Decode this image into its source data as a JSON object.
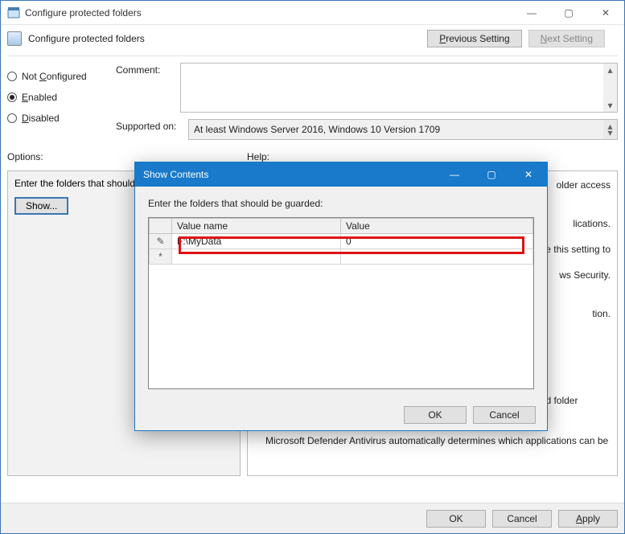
{
  "window": {
    "title": "Configure protected folders",
    "subtitle": "Configure protected folders",
    "minimize": "—",
    "maximize": "▢",
    "close": "✕"
  },
  "nav": {
    "previous": "Previous Setting",
    "next": "Next Setting",
    "prev_u": "P",
    "next_u": "N"
  },
  "radios": {
    "not_configured": "Not Configured",
    "enabled": "Enabled",
    "disabled": "Disabled",
    "nc_u": "C",
    "en_u": "E",
    "di_u": "D",
    "selected": "enabled"
  },
  "labels": {
    "comment": "Comment:",
    "supported": "Supported on:",
    "options": "Options:",
    "help": "Help:",
    "enter_folders": "Enter the folders that should b",
    "show": "Show...",
    "ok": "OK",
    "cancel": "Cancel",
    "apply": "Apply",
    "apply_u": "A"
  },
  "supported_on": "At least Windows Server 2016, Windows 10 Version 1709",
  "help_text": {
    "p1": "older access",
    "p2": "lications.",
    "p3": "e this setting to",
    "p4": "ws Security.",
    "p5": "tion.",
    "p6": "You can enable controlled folder access in the Configure controlled folder access GP setting.",
    "p7": "Microsoft Defender Antivirus automatically determines which applications can be"
  },
  "dialog": {
    "title": "Show Contents",
    "prompt": "Enter the folders that should be guarded:",
    "minimize": "—",
    "maximize": "▢",
    "close": "✕",
    "columns": {
      "name": "Value name",
      "value": "Value"
    },
    "rows": [
      {
        "marker": "✎",
        "name": "F:\\MyData",
        "value": "0"
      },
      {
        "marker": "*",
        "name": "",
        "value": ""
      }
    ],
    "ok": "OK",
    "cancel": "Cancel"
  }
}
